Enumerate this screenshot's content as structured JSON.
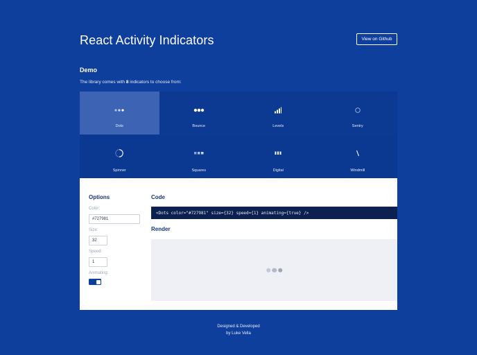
{
  "header": {
    "title": "React Activity Indicators",
    "github_label": "View on Github"
  },
  "demo": {
    "heading": "Demo",
    "intro_prefix": "The library comes with ",
    "intro_count": "8",
    "intro_suffix": " indicators to choose from:"
  },
  "indicators": [
    {
      "label": "Dots",
      "icon": "dots-icon",
      "selected": true
    },
    {
      "label": "Bounce",
      "icon": "bounce-icon",
      "selected": false
    },
    {
      "label": "Levels",
      "icon": "levels-icon",
      "selected": false
    },
    {
      "label": "Sentry",
      "icon": "sentry-icon",
      "selected": false
    },
    {
      "label": "Spinner",
      "icon": "spinner-icon",
      "selected": false
    },
    {
      "label": "Squares",
      "icon": "squares-icon",
      "selected": false
    },
    {
      "label": "Digital",
      "icon": "digital-icon",
      "selected": false
    },
    {
      "label": "Windmill",
      "icon": "windmill-icon",
      "selected": false
    }
  ],
  "options": {
    "title": "Options",
    "color_label": "Color:",
    "color_value": "#727981",
    "size_label": "Size:",
    "size_value": "32",
    "speed_label": "Speed:",
    "speed_value": "1",
    "animating_label": "Animating:",
    "animating_value": true
  },
  "code": {
    "title": "Code",
    "snippet": "<Dots color=\"#727981\" size={32} speed={1} animating={true} />"
  },
  "render": {
    "title": "Render",
    "dot_colors": [
      "#c4c9d3",
      "#b3b9c6",
      "#9ea6b7"
    ]
  },
  "footer": {
    "line1": "Designed & Developed",
    "line2": "by Luke Vella"
  },
  "colors": {
    "background": "#0e3f9c",
    "selected_tile": "#3d64b4",
    "code_bg": "#0c2150",
    "accent": "#18367a"
  }
}
